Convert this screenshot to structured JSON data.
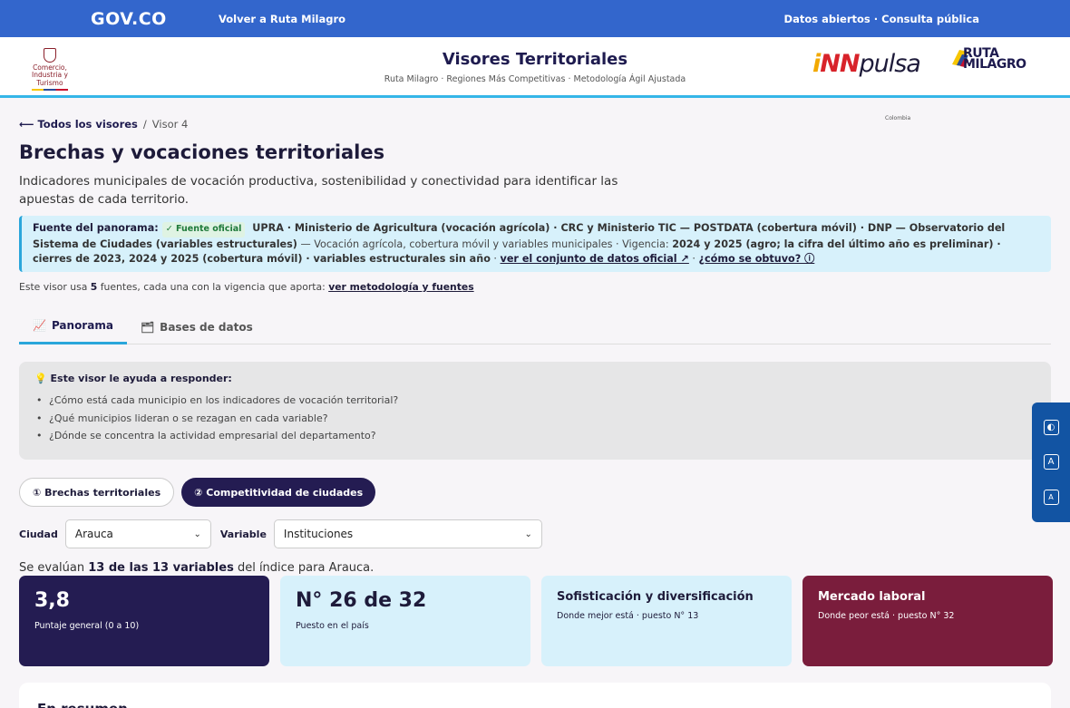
{
  "govbar": {
    "logo": "GOV.CO",
    "back_link": "Volver a Ruta Milagro",
    "right_links": "Datos abiertos · Consulta pública"
  },
  "header": {
    "ministry_logo_text": "Comercio, Industria y Turismo",
    "title": "Visores Territoriales",
    "subtitle": "Ruta Milagro · Regiones Más Competitivas · Metodología Ágil Ajustada",
    "innpulsa_logo": {
      "p1": "i",
      "p2": "NN",
      "p3": "pulsa",
      "sub": "Colombia"
    },
    "ruta_logo": "RUTA MILAGRO"
  },
  "breadcrumb": {
    "back": "⟵ Todos los visores",
    "sep": "/",
    "current": "Visor 4"
  },
  "page": {
    "title": "Brechas y vocaciones territoriales",
    "description": "Indicadores municipales de vocación productiva, sostenibilidad y conectividad para identificar las apuestas de cada territorio."
  },
  "source": {
    "label": "Fuente del panorama:",
    "badge": "✓ Fuente oficial",
    "entities": "UPRA · Ministerio de Agricultura (vocación agrícola) · CRC y Ministerio TIC — POSTDATA (cobertura móvil) · DNP — Observatorio del Sistema de Ciudades (variables estructurales)",
    "dash": " — ",
    "topics": "Vocación agrícola, cobertura móvil y variables municipales · Vigencia: ",
    "vigencia": "2024 y 2025 (agro; la cifra del último año es preliminar) · cierres de 2023, 2024 y 2025 (cobertura móvil) · variables estructurales sin año",
    "sep": " · ",
    "link_data": "ver el conjunto de datos oficial ↗",
    "link_how": "¿cómo se obtuvo? ⓘ"
  },
  "source_note": {
    "pre": "Este visor usa ",
    "count": "5",
    "mid": " fuentes, cada una con la vigencia que aporta: ",
    "link": "ver metodología y fuentes"
  },
  "tabs": [
    {
      "icon": "📈",
      "label": "Panorama"
    },
    {
      "icon": "🗂",
      "label": "Bases de datos"
    }
  ],
  "helper": {
    "icon": "💡",
    "title": "Este visor le ayuda a responder:",
    "items": [
      "¿Cómo está cada municipio en los indicadores de vocación territorial?",
      "¿Qué municipios lideran o se rezagan en cada variable?",
      "¿Dónde se concentra la actividad empresarial del departamento?"
    ]
  },
  "pills": [
    {
      "label": "① Brechas territoriales"
    },
    {
      "label": "② Competitividad de ciudades"
    }
  ],
  "filters": {
    "city_label": "Ciudad",
    "city_value": "Arauca",
    "variable_label": "Variable",
    "variable_value": "Instituciones"
  },
  "eval": {
    "pre": "Se evalúan ",
    "count": "13 de las 13 variables",
    "post": " del índice para Arauca."
  },
  "cards": [
    {
      "big": "3,8",
      "sub": "Puntaje general (0 a 10)"
    },
    {
      "big": "N° 26 de 32",
      "sub": "Puesto en el país"
    },
    {
      "mid": "Sofisticación y diversificación",
      "sub": "Donde mejor está · puesto N° 13"
    },
    {
      "mid": "Mercado laboral",
      "sub": "Donde peor está · puesto N° 32"
    }
  ],
  "summary": {
    "title": "En resumen"
  },
  "a11y": {
    "contrast": "◐",
    "increase": "A",
    "decrease": "A"
  },
  "colors": {
    "gov_blue": "#3366cc",
    "navy": "#241c52",
    "sky": "#d7f1fb",
    "wine": "#7a1d3c",
    "accent": "#2aa6db"
  }
}
